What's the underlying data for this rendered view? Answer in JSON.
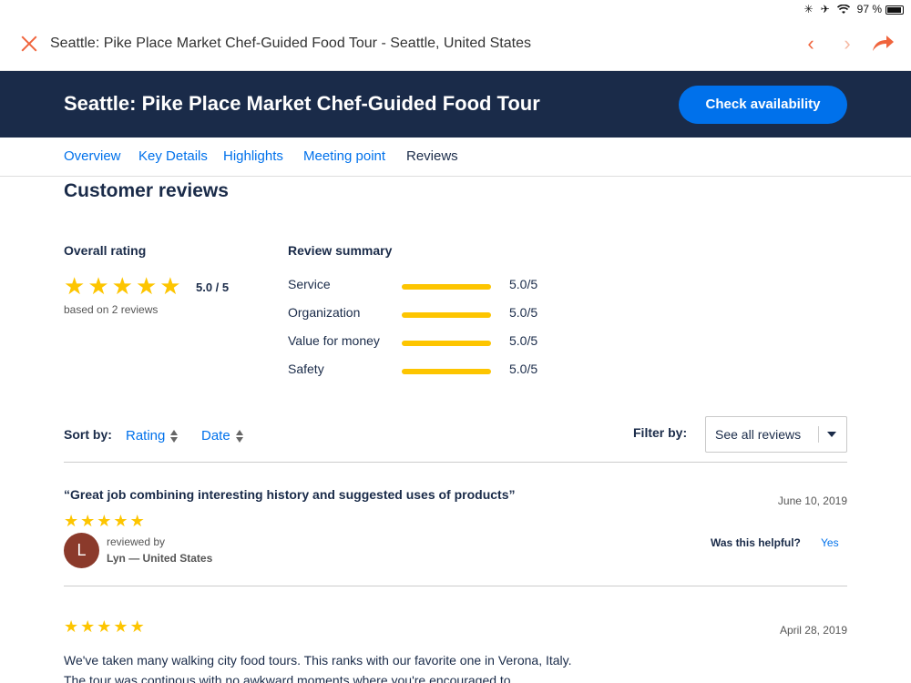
{
  "status_bar": {
    "battery": "97 %"
  },
  "browser": {
    "title": "Seattle: Pike Place Market Chef-Guided Food Tour - Seattle, United States",
    "prev_glyph": "‹",
    "next_glyph": "›"
  },
  "header": {
    "title": "Seattle: Pike Place Market Chef-Guided Food Tour",
    "cta": "Check availability"
  },
  "tabs": [
    {
      "label": "Overview"
    },
    {
      "label": "Key Details"
    },
    {
      "label": "Highlights"
    },
    {
      "label": "Meeting point"
    },
    {
      "label": "Reviews"
    }
  ],
  "reviews_section": {
    "title": "Customer reviews",
    "overall": {
      "label": "Overall rating",
      "stars": 5,
      "value": "5.0 / 5",
      "based_on": "based on 2 reviews"
    },
    "summary": {
      "label": "Review summary",
      "rows": [
        {
          "name": "Service",
          "score": "5.0/5",
          "fraction": 1.0
        },
        {
          "name": "Organization",
          "score": "5.0/5",
          "fraction": 1.0
        },
        {
          "name": "Value for money",
          "score": "5.0/5",
          "fraction": 1.0
        },
        {
          "name": "Safety",
          "score": "5.0/5",
          "fraction": 1.0
        }
      ]
    },
    "sort": {
      "label": "Sort by:",
      "options": [
        "Rating",
        "Date"
      ]
    },
    "filter": {
      "label": "Filter by:",
      "value": "See all reviews"
    }
  },
  "reviews": [
    {
      "title": "“Great job combining interesting history and suggested uses of products”",
      "date": "June 10, 2019",
      "stars": 5,
      "avatar_initial": "L",
      "reviewed_by": "reviewed by",
      "reviewer": "Lyn — United States",
      "helpful_label": "Was this helpful?",
      "helpful_yes": "Yes"
    },
    {
      "date": "April 28, 2019",
      "stars": 5,
      "text": "We've taken many walking city food tours. This ranks with our favorite one in Verona, Italy. The tour was continous with no awkward moments where you're encouraged to"
    }
  ],
  "colors": {
    "accent": "#0071eb",
    "navy": "#1a2b49",
    "star": "#fdc500",
    "close": "#f0643c"
  }
}
